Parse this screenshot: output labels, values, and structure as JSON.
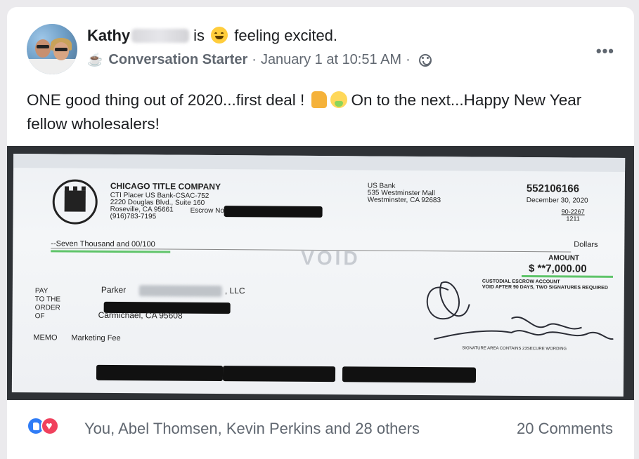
{
  "post": {
    "author_name": "Kathy",
    "status_is": "is",
    "feeling_text": "feeling excited.",
    "group_name": "Conversation Starter",
    "separator": "·",
    "timestamp": "January 1 at 10:51 AM",
    "separator2": "·",
    "more_icon": "more-horizontal-icon",
    "text_part1": "ONE good thing out of 2020...first deal !",
    "text_part2": "On to the next...Happy New Year fellow wholesalers!"
  },
  "check": {
    "company": "CHICAGO TITLE COMPANY",
    "company_address": "CTI Placer US Bank-CSAC-752\n2220 Douglas Blvd., Suite 160\nRoseville, CA 95661\n(916)783-7195",
    "escrow_label": "Escrow No",
    "bank": "US Bank\n535 Westminster Mall\nWestminster, CA 92683",
    "check_number": "552106166",
    "date": "December 30, 2020",
    "routing_top": "90-2267",
    "routing_bottom": "1211",
    "amount_words": "--Seven Thousand and 00/100",
    "dollars_label": "Dollars",
    "amount_label": "AMOUNT",
    "amount": "$ **7,000.00",
    "custodial_note": "CUSTODIAL ESCROW ACCOUNT\nVOID AFTER 90 DAYS, TWO SIGNATURES REQUIRED",
    "pay_label": "PAY\nTO THE\nORDER\nOF",
    "payee": "Parker",
    "payee_suffix": ", LLC",
    "payee_city": "Carmichael, CA 95608",
    "memo_label": "MEMO",
    "memo": "Marketing Fee",
    "sig_area_note": "SIGNATURE AREA CONTAINS 23SECURE WORDING"
  },
  "reactions": {
    "names": "You, Abel Thomsen, Kevin Perkins and 28 others",
    "comments": "20 Comments"
  }
}
